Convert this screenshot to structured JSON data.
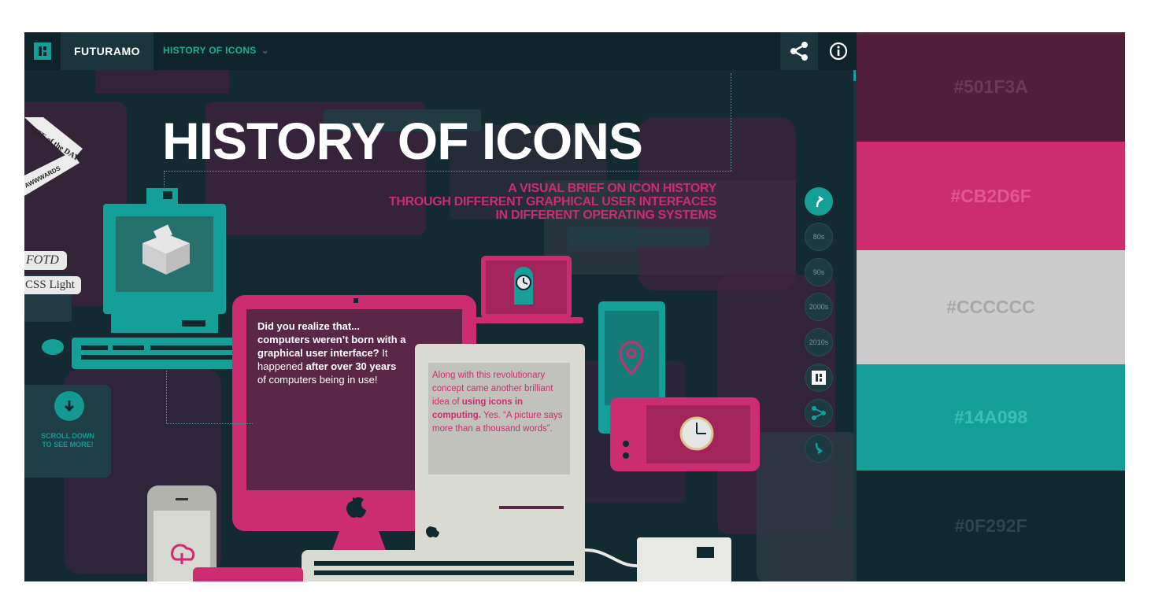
{
  "topbar": {
    "brand": "FUTURAMO",
    "section_label": "HISTORY OF ICONS"
  },
  "hero": {
    "title": "HISTORY OF ICONS",
    "subtitle_lines": [
      "A VISUAL BRIEF ON ICON HISTORY",
      "THROUGH DIFFERENT GRAPHICAL USER INTERFACES",
      "IN DIFFERENT OPERATING SYSTEMS"
    ]
  },
  "badges": {
    "ribbon_line1": "SITE of the DAY",
    "ribbon_line2": "AWWWARDS",
    "fotd": "FOTD",
    "css_light": "CSS Light"
  },
  "scroll_cta": {
    "line1": "SCROLL DOWN",
    "line2": "TO SEE MORE!"
  },
  "callout1": {
    "intro_bold": "Did you realize that... computers weren’t born with a graphical user interface?",
    "mid": " It happened ",
    "bold2": "after over 30 years",
    "end": " of computers being in use!"
  },
  "callout2": {
    "start": "Along with this revolutionary concept came another brilliant idea of ",
    "bold": "using icons in computing.",
    "end": " Yes. “A picture says more than a thousand words”."
  },
  "timeline_nav": {
    "items": [
      "80s",
      "90s",
      "2000s",
      "2010s"
    ]
  },
  "palette": [
    {
      "hex": "#501F3A",
      "bg": "#501f3a",
      "fg": "#6b3a55"
    },
    {
      "hex": "#CB2D6F",
      "bg": "#cb2d6f",
      "fg": "#e0588f"
    },
    {
      "hex": "#CCCCCC",
      "bg": "#cccccc",
      "fg": "#a7a7a7"
    },
    {
      "hex": "#14A098",
      "bg": "#14a098",
      "fg": "#3fbdb4"
    },
    {
      "hex": "#0F292F",
      "bg": "#0f292f",
      "fg": "#2b474c"
    }
  ],
  "colors": {
    "accent_teal": "#14a098",
    "accent_pink": "#cb2d6f",
    "dark_bg": "#142a31"
  }
}
